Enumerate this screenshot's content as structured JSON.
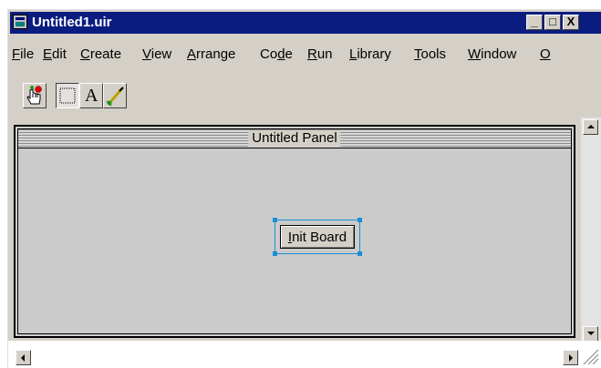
{
  "window": {
    "title": "Untitled1.uir",
    "title_bar_color": "#0b1c80",
    "controls": {
      "minimize": "_",
      "maximize": "□",
      "close": "X"
    }
  },
  "menu": {
    "items": [
      {
        "label": "File",
        "mnemonic": "F",
        "rest": "ile"
      },
      {
        "label": "Edit",
        "mnemonic": "E",
        "rest": "dit"
      },
      {
        "label": "Create",
        "mnemonic": "C",
        "rest": "reate"
      },
      {
        "label": "View",
        "mnemonic": "V",
        "rest": "iew"
      },
      {
        "label": "Arrange",
        "mnemonic": "A",
        "rest": "rrange"
      },
      {
        "label": "Code",
        "pre": "Co",
        "mnemonic": "d",
        "rest": "e"
      },
      {
        "label": "Run",
        "mnemonic": "R",
        "rest": "un"
      },
      {
        "label": "Library",
        "mnemonic": "L",
        "rest": "ibrary"
      },
      {
        "label": "Tools",
        "mnemonic": "T",
        "rest": "ools"
      },
      {
        "label": "Window",
        "mnemonic": "W",
        "rest": "indow"
      },
      {
        "label": "O",
        "mnemonic": "O",
        "rest": ""
      }
    ]
  },
  "toolbar": {
    "tools": [
      {
        "icon": "operate-hand-icon",
        "pressed": false
      },
      {
        "icon": "selection-box-icon",
        "pressed": true
      },
      {
        "icon": "text-label-icon",
        "glyph": "A",
        "pressed": false
      },
      {
        "icon": "color-brush-icon",
        "pressed": false
      }
    ]
  },
  "panel": {
    "title": "Untitled Panel",
    "button": {
      "label": "Init Board",
      "mnemonic": "I",
      "rest": "nit Board",
      "selected": true
    },
    "selection_color": "#1b8fd4"
  }
}
